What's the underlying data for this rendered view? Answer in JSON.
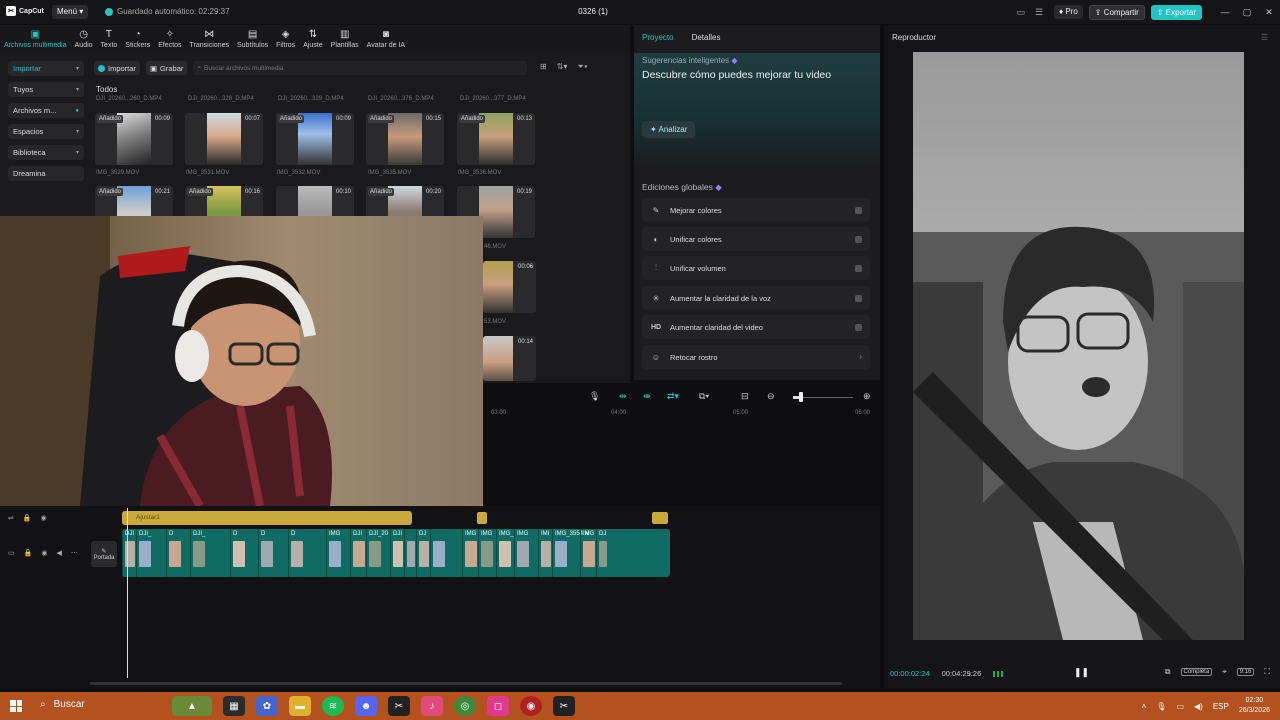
{
  "titlebar": {
    "app_name": "CapCut",
    "menu_label": "Menú",
    "autosave": "Guardado automático: 02:29:37",
    "document_title": "0326 (1)",
    "pro_label": "Pro",
    "share_label": "Compartir",
    "export_label": "Exportar"
  },
  "toolbar": {
    "items": [
      {
        "label": "Archivos multimedia",
        "icon": "media-icon"
      },
      {
        "label": "Audio",
        "icon": "audio-icon"
      },
      {
        "label": "Texto",
        "icon": "text-icon"
      },
      {
        "label": "Stickers",
        "icon": "sticker-icon"
      },
      {
        "label": "Efectos",
        "icon": "effects-icon"
      },
      {
        "label": "Transiciones",
        "icon": "transitions-icon"
      },
      {
        "label": "Subtítulos",
        "icon": "subtitles-icon"
      },
      {
        "label": "Filtros",
        "icon": "filters-icon"
      },
      {
        "label": "Ajuste",
        "icon": "adjust-icon"
      },
      {
        "label": "Plantillas",
        "icon": "templates-icon"
      },
      {
        "label": "Avatar de IA",
        "icon": "avatar-icon"
      }
    ]
  },
  "media": {
    "side": [
      "Importar",
      "Tuyos",
      "Archivos m...",
      "Espacios",
      "Biblioteca",
      "Dreamina"
    ],
    "import_label": "Importar",
    "record_label": "Grabar",
    "search_placeholder": "Buscar archivos multimedia",
    "all_label": "Todos",
    "top_names": [
      "DJI_20260...260_D.MP4",
      "DJI_20260...328_D.MP4",
      "DJI_20260...329_D.MP4",
      "DJI_20260...376_D.MP4",
      "DJI_20260...377_D.MP4"
    ],
    "row1": [
      {
        "tag": "Añadido",
        "dur": "00:09",
        "name": "IMG_3529.MOV"
      },
      {
        "tag": "",
        "dur": "00:07",
        "name": "IMG_3531.MOV"
      },
      {
        "tag": "Añadido",
        "dur": "00:09",
        "name": "IMG_3532.MOV"
      },
      {
        "tag": "Añadido",
        "dur": "00:15",
        "name": "IMG_3535.MOV"
      },
      {
        "tag": "Añadido",
        "dur": "00:13",
        "name": "IMG_3536.MOV"
      }
    ],
    "row2": [
      {
        "tag": "Añadido",
        "dur": "00:21"
      },
      {
        "tag": "Añadido",
        "dur": "00:16"
      },
      {
        "tag": "",
        "dur": "00:10"
      },
      {
        "tag": "Añadido",
        "dur": "00:20"
      },
      {
        "tag": "",
        "dur": "00:19"
      }
    ],
    "partial_labels": [
      "46.MOV",
      "53.MOV"
    ],
    "partial_durs": [
      "00:06",
      "00:14"
    ]
  },
  "project": {
    "tab_project": "Proyecto",
    "tab_details": "Detalles",
    "suggestions_label": "Sugerencias inteligentes",
    "hero_title": "Descubre cómo puedes mejorar tu video",
    "analyze_label": "Analizar",
    "global_edits_label": "Ediciones globales",
    "edits": [
      {
        "label": "Mejorar colores",
        "icon": "magic-wand-icon",
        "kind": "toggle"
      },
      {
        "label": "Unificar colores",
        "icon": "palette-icon",
        "kind": "toggle"
      },
      {
        "label": "Unificar volumen",
        "icon": "equalizer-icon",
        "kind": "toggle"
      },
      {
        "label": "Aumentar la claridad de la voz",
        "icon": "voice-clarity-icon",
        "kind": "toggle"
      },
      {
        "label": "Aumentar claridad del video",
        "icon": "hd-icon",
        "kind": "toggle"
      },
      {
        "label": "Retocar rostro",
        "icon": "face-retouch-icon",
        "kind": "arrow"
      }
    ]
  },
  "player": {
    "title": "Reproductor",
    "current_time": "00:00:02:24",
    "total_time": "00:04:29:26",
    "full_label": "Completa",
    "ratio_label": "9:16"
  },
  "timeline": {
    "ruler": [
      "03:00",
      "04:00",
      "05:00",
      "06:00"
    ],
    "audio_label": "Ajustar1",
    "cover_label": "Portada",
    "clips": [
      {
        "label": "DJI",
        "w": 14
      },
      {
        "label": "DJI_",
        "w": 30
      },
      {
        "label": "D",
        "w": 24
      },
      {
        "label": "DJI_",
        "w": 40
      },
      {
        "label": "D",
        "w": 28
      },
      {
        "label": "D",
        "w": 30
      },
      {
        "label": "D",
        "w": 38
      },
      {
        "label": "IMG",
        "w": 24
      },
      {
        "label": "DJI",
        "w": 16
      },
      {
        "label": "DJI_20",
        "w": 24
      },
      {
        "label": "DJI",
        "w": 14
      },
      {
        "label": "",
        "w": 12
      },
      {
        "label": "DJ",
        "w": 14
      },
      {
        "label": "",
        "w": 32
      },
      {
        "label": "IMG",
        "w": 16
      },
      {
        "label": "IMG",
        "w": 18
      },
      {
        "label": "IMG_",
        "w": 18
      },
      {
        "label": "IMG",
        "w": 24
      },
      {
        "label": "IMI",
        "w": 14
      },
      {
        "label": "IMG_3554.N",
        "w": 28
      },
      {
        "label": "IMG",
        "w": 16
      },
      {
        "label": "DJ",
        "w": 12
      }
    ]
  },
  "taskbar": {
    "search_label": "Buscar",
    "lang": "ESP",
    "time": "02:30",
    "date": "26/3/2026"
  }
}
